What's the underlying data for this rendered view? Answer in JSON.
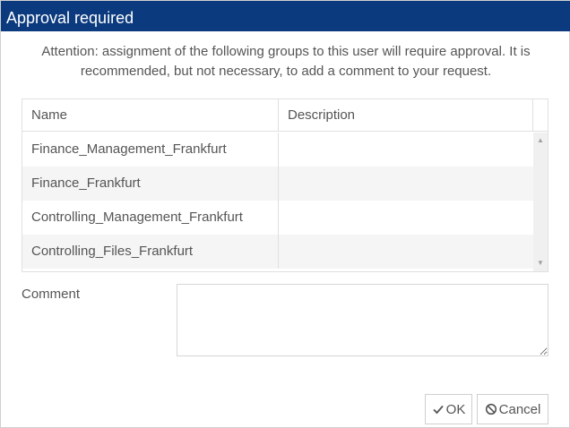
{
  "dialog": {
    "title": "Approval required",
    "message": "Attention: assignment of the following groups to this user will require approval. It is recommended, but not necessary, to add a comment to your request."
  },
  "grid": {
    "columns": [
      "Name",
      "Description"
    ],
    "rows": [
      {
        "name": "Finance_Management_Frankfurt",
        "description": ""
      },
      {
        "name": "Finance_Frankfurt",
        "description": ""
      },
      {
        "name": "Controlling_Management_Frankfurt",
        "description": ""
      },
      {
        "name": "Controlling_Files_Frankfurt",
        "description": ""
      }
    ]
  },
  "comment": {
    "label": "Comment",
    "value": ""
  },
  "buttons": {
    "ok": {
      "label": "OK",
      "icon": "check-icon"
    },
    "cancel": {
      "label": "Cancel",
      "icon": "ban-icon"
    }
  },
  "colors": {
    "titlebar": "#0b3a7e",
    "text": "#555555",
    "row_alt": "#f5f5f5",
    "border": "#e0e0e0"
  }
}
